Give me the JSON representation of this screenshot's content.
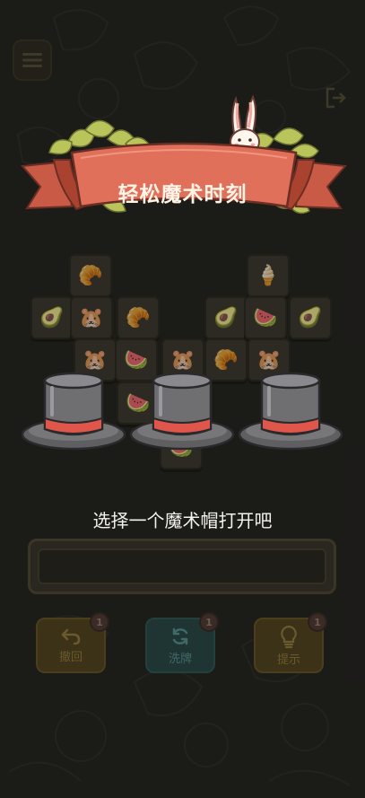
{
  "banner": {
    "title": "轻松魔术时刻"
  },
  "prompt": {
    "text": "选择一个魔术帽打开吧"
  },
  "toolbar": {
    "undo_label": "撤回",
    "undo_count": "1",
    "shuffle_label": "洗牌",
    "shuffle_count": "1",
    "hint_label": "提示",
    "hint_count": "1"
  },
  "icons": {
    "menu": "menu-icon",
    "exit": "exit-icon",
    "undo": "undo-arrow-icon",
    "shuffle": "refresh-icon",
    "hint": "lightbulb-icon",
    "rabbit": "rabbit-icon",
    "hat": "top-hat-icon"
  },
  "tiles": [
    "🥐",
    "🍦",
    "🥑",
    "🐹",
    "🥐",
    "🥑",
    "🍉",
    "🥑",
    "🍉",
    "🐹",
    "🐹",
    "🥐",
    "🍉",
    "🍉",
    "🥐"
  ],
  "hats": [
    "hat-1",
    "hat-2",
    "hat-3"
  ],
  "colors": {
    "ribbon": "#e0705a",
    "ribbon_dark": "#b24a3a",
    "leaves": "#b9c55a",
    "hat_body": "#6f6f72",
    "hat_band": "#e0564a",
    "background": "#232220"
  }
}
